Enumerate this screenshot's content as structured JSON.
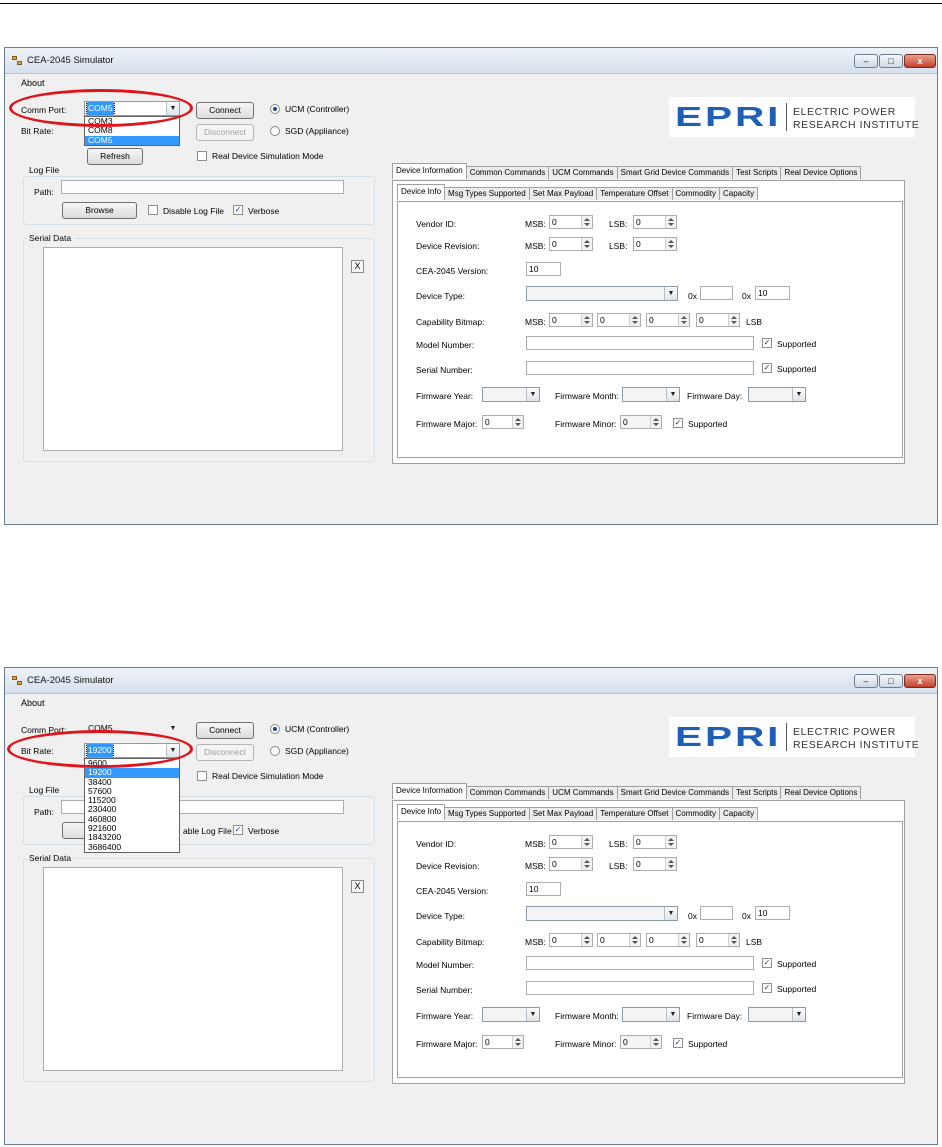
{
  "app": {
    "title": "CEA-2045 Simulator",
    "menu_about": "About",
    "minimize_glyph": "–",
    "maximize_glyph": "□",
    "close_glyph": "x"
  },
  "connection": {
    "comm_port_label": "Comm Port:",
    "bit_rate_label": "Bit Rate:",
    "connect_label": "Connect",
    "disconnect_label": "Disconnect",
    "refresh_label": "Refresh",
    "ucm_label": "UCM (Controller)",
    "sgd_label": "SGD (Appliance)",
    "real_device_label": "Real Device Simulation Mode"
  },
  "log": {
    "group_title": "Log File",
    "path_label": "Path:",
    "browse_label": "Browse",
    "disable_label": "Disable Log File",
    "disable_label_partial": "able Log File",
    "verbose_label": "Verbose"
  },
  "serial": {
    "group_title": "Serial Data",
    "clear_label": "X"
  },
  "logo": {
    "mark": "EPRI",
    "line1": "ELECTRIC POWER",
    "line2": "RESEARCH INSTITUTE"
  },
  "main_tabs": [
    "Device Information",
    "Common Commands",
    "UCM Commands",
    "Smart Grid Device Commands",
    "Test Scripts",
    "Real Device Options"
  ],
  "sub_tabs": [
    "Device Info",
    "Msg Types Supported",
    "Set Max Payload",
    "Temperature Offset",
    "Commodity",
    "Capacity"
  ],
  "device_info": {
    "vendor_id_label": "Vendor ID:",
    "device_revision_label": "Device Revision:",
    "msb_label": "MSB:",
    "lsb_label": "LSB:",
    "lsb_suffix": "LSB",
    "zero": "0",
    "cea_version_label": "CEA-2045 Version:",
    "cea_version_value": "10",
    "device_type_label": "Device Type:",
    "hex_prefix": "0x",
    "device_type_hex2": "10",
    "capability_label": "Capability Bitmap:",
    "model_label": "Model Number:",
    "serial_label": "Serial Number:",
    "supported_label": "Supported",
    "fw_year_label": "Firmware Year:",
    "fw_month_label": "Firmware Month:",
    "fw_day_label": "Firmware Day:",
    "fw_major_label": "Firmware Major:",
    "fw_minor_label": "Firmware Minor:"
  },
  "screenshot1": {
    "comm_port_value": "COM5",
    "port_options": [
      "COM3",
      "COM8",
      "COM5"
    ],
    "port_selected_index": 2
  },
  "screenshot2": {
    "comm_port_value": "COM5",
    "bit_rate_value": "19200",
    "bitrate_options": [
      "9600",
      "19200",
      "38400",
      "57600",
      "115200",
      "230400",
      "460800",
      "921600",
      "1843200",
      "3686400"
    ],
    "bitrate_selected_index": 1
  }
}
